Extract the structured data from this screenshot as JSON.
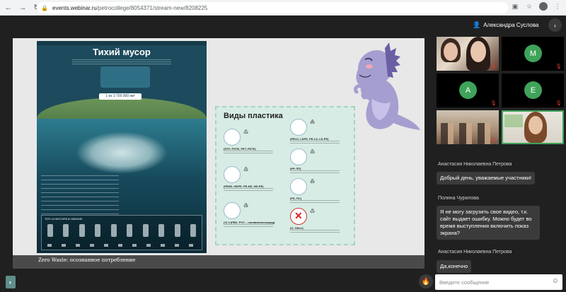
{
  "browser": {
    "url_host": "events.webinar.ru",
    "url_path": "/petrocollege/8054371/stream-new/8208225"
  },
  "header": {
    "user_name": "Александра Суслова"
  },
  "slide": {
    "poster_title": "Тихий мусор",
    "poster_badge": "1 из 1 700 000 км²",
    "poster_bottom_label": "ТОП-10 МУСОРА В ОКЕАНЕ:",
    "plastic_title": "Виды пластика",
    "plastic_types": [
      {
        "code": "(ПЭТ, ПЭТЕ, PET, PETE)",
        "num": "1",
        "icon_color": "#4caf50"
      },
      {
        "code": "(PEHD, HDPE, PE-HD, HD-PE)",
        "num": "2",
        "icon_color": "#e53935"
      },
      {
        "code": "(V) 3 (ПВХ, PVC – поливинилхлорид)",
        "num": "3",
        "icon_color": "#c62828"
      },
      {
        "code": "(PELD, LDPE, PE-LS, LD-PE)",
        "num": "4",
        "icon_color": "#d4a017"
      },
      {
        "code": "(PP, ПП)",
        "num": "5",
        "icon_color": "#1e88e5"
      },
      {
        "code": "(PS, ПС)",
        "num": "6",
        "icon_color": "#b0a070"
      },
      {
        "code": "(O, Other)",
        "num": "7",
        "icon_color": "#d22"
      }
    ],
    "caption": "Zero Waste: осознанное потребление"
  },
  "participants": [
    {
      "type": "camera",
      "name": "participant-1"
    },
    {
      "type": "avatar",
      "letter": "M",
      "color": "#3fa35a"
    },
    {
      "type": "avatar",
      "letter": "A",
      "color": "#3fa35a"
    },
    {
      "type": "avatar",
      "letter": "E",
      "color": "#3fa35a"
    },
    {
      "type": "camera",
      "name": "participant-5"
    },
    {
      "type": "camera",
      "name": "participant-6"
    }
  ],
  "chat": {
    "messages": [
      {
        "author": "Анастасия Николаевна Петрова",
        "text": "Добрый день, уважаемые участники!"
      },
      {
        "author": "Полина Чурилова",
        "text_lines": [
          "Я не могу загрузить свое видео, т.к.",
          "сайт выдает ошибку. Можно будет во",
          "время выступления включить показ",
          "экрана?"
        ]
      },
      {
        "author": "Анастасия Николаевна Петрова",
        "text": "Да,конечно"
      }
    ],
    "input_placeholder": "Введите сообщение"
  },
  "icons": {
    "back": "back-arrow-icon",
    "forward": "forward-arrow-icon",
    "reload": "reload-icon",
    "lock": "lock-icon",
    "star": "star-icon",
    "mic_off": "mic-off-icon",
    "emoji": "emoji-icon",
    "fire": "fire-icon"
  }
}
